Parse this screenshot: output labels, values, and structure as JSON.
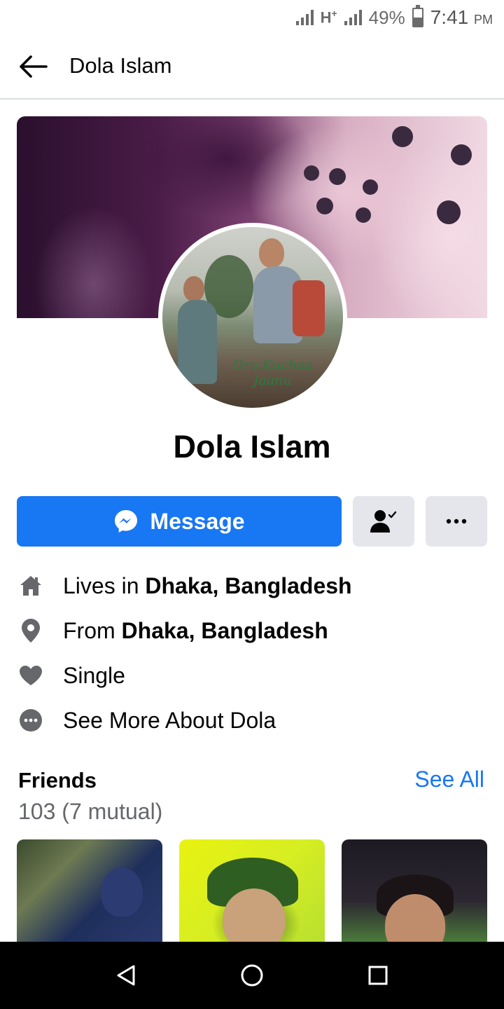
{
  "status_bar": {
    "network": "H",
    "network_sup": "+",
    "battery_percent": "49%",
    "battery_level": 0.49,
    "time": "7:41",
    "time_suffix": "PM"
  },
  "header": {
    "title": "Dola Islam"
  },
  "profile": {
    "name": "Dola Islam",
    "avatar_caption_line1": "Oru Kuchna",
    "avatar_caption_line2": "Jaanu"
  },
  "actions": {
    "message_label": "Message"
  },
  "info": {
    "lives_prefix": "Lives in ",
    "lives_value": "Dhaka, Bangladesh",
    "from_prefix": "From ",
    "from_value": "Dhaka, Bangladesh",
    "relationship": "Single",
    "see_more": "See More About Dola"
  },
  "friends": {
    "title": "Friends",
    "see_all": "See All",
    "count": "103 (7 mutual)"
  },
  "colors": {
    "accent": "#1877f2",
    "button_gray": "#e4e6eb",
    "secondary_text": "#65676b"
  },
  "icons": {
    "back": "arrow-left-icon",
    "messenger": "messenger-icon",
    "friends_status": "person-check-icon",
    "more": "more-horizontal-icon",
    "home": "home-icon",
    "location": "location-pin-icon",
    "relationship": "heart-icon",
    "see_more": "ellipsis-circle-icon"
  }
}
